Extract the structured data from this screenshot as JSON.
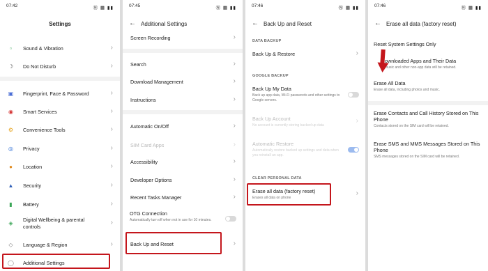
{
  "screen1": {
    "time": "07:42",
    "status_icons": "Ⓝ ▦ ▮▮",
    "title": "Settings",
    "items": [
      {
        "label": "Sound & Vibration",
        "icon": "speaker-icon"
      },
      {
        "label": "Do Not Disturb",
        "icon": "moon-icon"
      },
      {
        "label": "Fingerprint, Face & Password",
        "icon": "lock-icon"
      },
      {
        "label": "Smart Services",
        "icon": "target-icon"
      },
      {
        "label": "Convenience Tools",
        "icon": "tools-icon"
      },
      {
        "label": "Privacy",
        "icon": "eye-icon"
      },
      {
        "label": "Location",
        "icon": "location-pin-icon"
      },
      {
        "label": "Security",
        "icon": "shield-icon"
      },
      {
        "label": "Battery",
        "icon": "battery-icon"
      },
      {
        "label": "Digital Wellbeing & parental controls",
        "icon": "wellbeing-icon"
      },
      {
        "label": "Language & Region",
        "icon": "language-icon"
      },
      {
        "label": "Additional Settings",
        "icon": "gear-icon"
      }
    ]
  },
  "screen2": {
    "time": "07:45",
    "status_icons": "Ⓝ ▦ ▮▮",
    "title": "Additional Settings",
    "items": [
      {
        "label": "Screen Recording"
      },
      {
        "label": "Search"
      },
      {
        "label": "Download Management"
      },
      {
        "label": "Instructions"
      },
      {
        "label": "Automatic On/Off"
      },
      {
        "label": "SIM Card Apps"
      },
      {
        "label": "Accessibility"
      },
      {
        "label": "Developer Options"
      },
      {
        "label": "Recent Tasks Manager"
      }
    ],
    "otg_title": "OTG Connection",
    "otg_desc": "Automatically turn off when not in use for 10 minutes.",
    "backup_reset": "Back Up and Reset"
  },
  "screen3": {
    "time": "07:46",
    "status_icons": "Ⓝ ▦ ▮▮",
    "title": "Back Up and Reset",
    "sec_data_backup": "DATA BACKUP",
    "backup_restore": "Back Up & Restore",
    "sec_google_backup": "GOOGLE BACKUP",
    "backup_my_data": "Back Up My Data",
    "backup_my_data_desc": "Back up app data, Wi-Fi passwords and other settings to Google servers.",
    "backup_account": "Back Up Account",
    "backup_account_desc": "No account is currently storing backed up data",
    "auto_restore": "Automatic Restore",
    "auto_restore_desc": "Automatically restore backed up settings and data when you reinstall an app.",
    "sec_clear_personal": "CLEAR PERSONAL DATA",
    "erase_all": "Erase all data (factory reset)",
    "erase_all_desc": "Erases all data on phone"
  },
  "screen4": {
    "time": "07:46",
    "status_icons": "Ⓝ ▦ ▮▮",
    "title": "Erase all data (factory reset)",
    "reset_system": "Reset System Settings Only",
    "downloaded_apps": "ownloaded Apps and Their Data",
    "downloaded_apps_desc": "music and other non-app data will be retained.",
    "erase_all": "Erase All Data",
    "erase_all_desc": "Erase all data, including photos and music.",
    "erase_contacts": "Erase Contacts and Call History Stored on This Phone",
    "erase_contacts_desc": "Contacts stored on the SIM card will be retained.",
    "erase_sms": "Erase SMS and MMS Messages Stored on This Phone",
    "erase_sms_desc": "SMS messages stored on the SIM card will be retained."
  },
  "colors": {
    "highlight": "#c4161c",
    "toggle_on": "#5b8ee6"
  }
}
